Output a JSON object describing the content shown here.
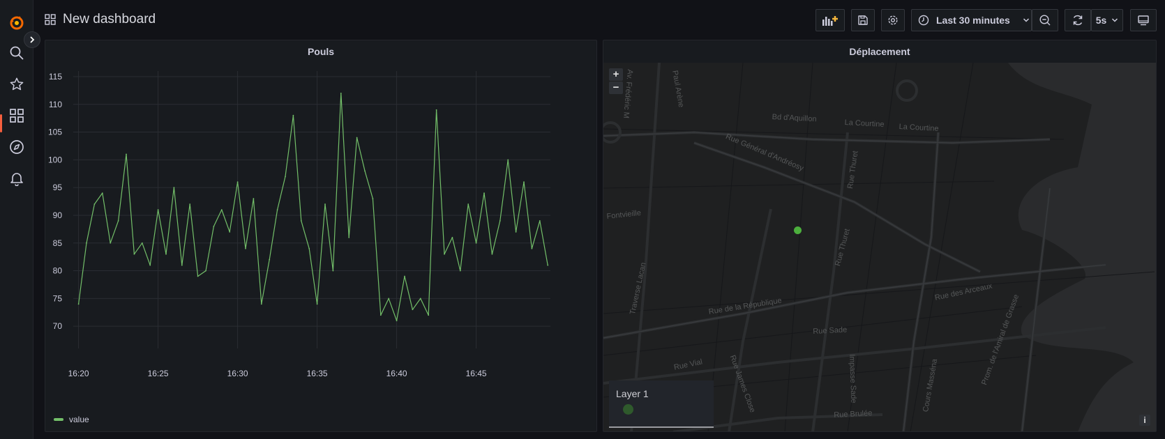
{
  "header": {
    "title": "New dashboard",
    "time_range": "Last 30 minutes",
    "refresh_interval": "5s"
  },
  "sidebar": {
    "items": [
      {
        "name": "grafana-logo"
      },
      {
        "name": "search-icon"
      },
      {
        "name": "star-icon"
      },
      {
        "name": "dashboards-icon",
        "active": true
      },
      {
        "name": "compass-icon"
      },
      {
        "name": "bell-icon"
      }
    ]
  },
  "panels": {
    "pouls": {
      "title": "Pouls",
      "legend": "value",
      "color": "#73bf69"
    },
    "deplacement": {
      "title": "Déplacement",
      "zoom_in": "+",
      "zoom_out": "−",
      "layer_title": "Layer 1",
      "info": "i",
      "marker_color": "#4caf3d",
      "streets": [
        "Bd d'Aquillon",
        "La Courtine",
        "La Courtine",
        "Rue Général d'Andréosy",
        "Rue Thuret",
        "Rue Thuret",
        "Fontvieille",
        "Traverse Lacan",
        "Rue de la République",
        "Rue des Arceaux",
        "Rue Sade",
        "Rue Vial",
        "Rue James Close",
        "Impasse Sade",
        "Cours Masséna",
        "Prom. de l'Amiral de Grasse",
        "Rue Brulée",
        "Paul Arène",
        "Av. Frédéric M"
      ]
    }
  },
  "chart_data": {
    "type": "line",
    "title": "Pouls",
    "xlabel": "",
    "ylabel": "",
    "x_ticks": [
      "16:20",
      "16:25",
      "16:30",
      "16:35",
      "16:40",
      "16:45"
    ],
    "y_ticks": [
      70,
      75,
      80,
      85,
      90,
      95,
      100,
      105,
      110,
      115
    ],
    "xlim": [
      "16:19:40",
      "16:49:40"
    ],
    "ylim": [
      66,
      116
    ],
    "grid": true,
    "legend_position": "bottom-left",
    "series": [
      {
        "name": "value",
        "color": "#73bf69",
        "x": [
          "16:20:00",
          "16:20:30",
          "16:21:00",
          "16:21:30",
          "16:22:00",
          "16:22:30",
          "16:23:00",
          "16:23:30",
          "16:24:00",
          "16:24:30",
          "16:25:00",
          "16:25:30",
          "16:26:00",
          "16:26:30",
          "16:27:00",
          "16:27:30",
          "16:28:00",
          "16:28:30",
          "16:29:00",
          "16:29:30",
          "16:30:00",
          "16:30:30",
          "16:31:00",
          "16:31:30",
          "16:32:00",
          "16:32:30",
          "16:33:00",
          "16:33:30",
          "16:34:00",
          "16:34:30",
          "16:35:00",
          "16:35:30",
          "16:36:00",
          "16:36:30",
          "16:37:00",
          "16:37:30",
          "16:38:00",
          "16:38:30",
          "16:39:00",
          "16:39:30",
          "16:40:00",
          "16:40:30",
          "16:41:00",
          "16:41:30",
          "16:42:00",
          "16:42:30",
          "16:43:00",
          "16:43:30",
          "16:44:00",
          "16:44:30",
          "16:45:00",
          "16:45:30",
          "16:46:00",
          "16:46:30",
          "16:47:00",
          "16:47:30",
          "16:48:00",
          "16:48:30",
          "16:49:00",
          "16:49:30"
        ],
        "y": [
          74,
          85,
          92,
          94,
          85,
          89,
          101,
          83,
          85,
          81,
          91,
          83,
          95,
          81,
          92,
          79,
          80,
          88,
          91,
          87,
          96,
          84,
          93,
          74,
          82,
          91,
          97,
          108,
          89,
          84,
          74,
          92,
          80,
          112,
          86,
          104,
          98,
          93,
          72,
          75,
          71,
          79,
          73,
          75,
          72,
          109,
          83,
          86,
          80,
          92,
          85,
          94,
          83,
          89,
          100,
          87,
          96,
          84,
          89,
          81
        ]
      }
    ]
  }
}
